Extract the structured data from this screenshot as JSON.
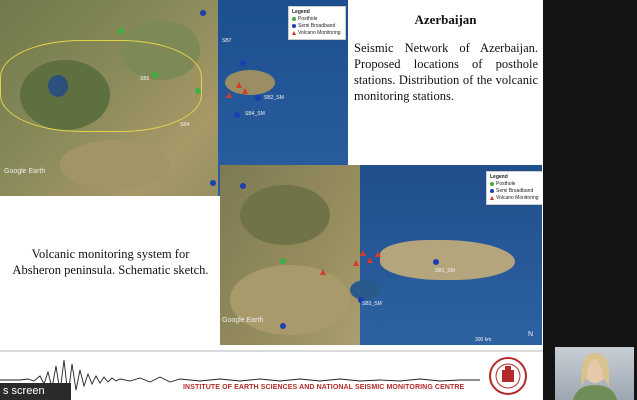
{
  "slide": {
    "title": "Azerbaijan",
    "description": "Seismic Network of Azerbaijan. Proposed locations of posthole stations. Distribution of the volcanic monitoring stations.",
    "caption": "Volcanic monitoring system for Absheron peninsula. Schematic sketch."
  },
  "maps": {
    "watermark": "Google Earth",
    "legend": {
      "title": "Legend",
      "items": [
        {
          "label": "Posthole",
          "color": "#3cb043",
          "icon": "green-dot"
        },
        {
          "label": "Semi Broadband",
          "color": "#1a3fb0",
          "icon": "blue-dot"
        },
        {
          "label": "Volcano Monitoring",
          "color": "#d63a2a",
          "icon": "red-triangle"
        }
      ]
    },
    "station_labels": [
      "SB7",
      "SB5",
      "SB4",
      "SB2",
      "SB1",
      "SB3",
      "SB6",
      "SB6_SM",
      "SB5_SM",
      "SB2_SM",
      "SB4_SM",
      "SB1_SM",
      "SB3_SM"
    ],
    "scale": "300 km"
  },
  "footer": {
    "institute": "INSTITUTE OF EARTH SCIENCES AND NATIONAL SEISMIC MONITORING CENTRE"
  },
  "overlay": {
    "share_label": "s screen"
  }
}
